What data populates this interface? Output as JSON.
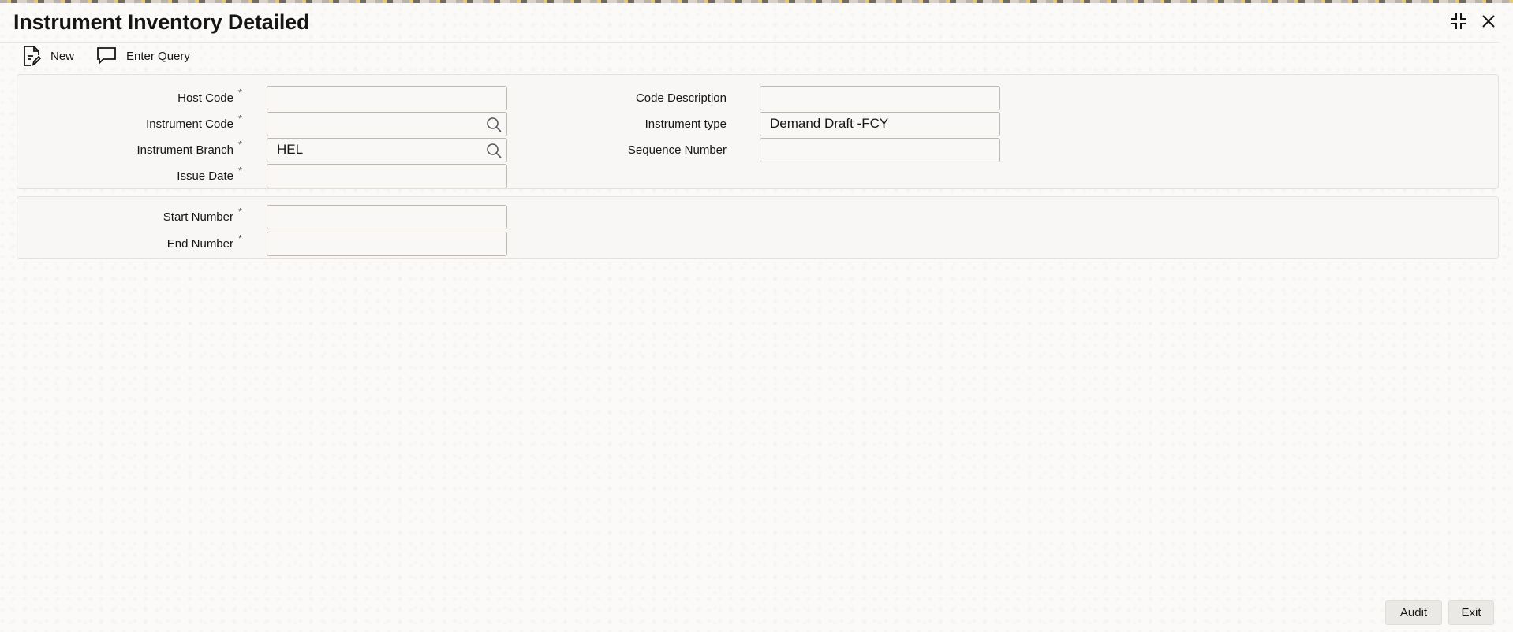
{
  "window": {
    "title": "Instrument Inventory Detailed",
    "controls": [
      "collapse-icon",
      "close-icon"
    ]
  },
  "toolbar": {
    "new_label": "New",
    "enter_query_label": "Enter Query"
  },
  "form": {
    "required_marker": "*",
    "host_code": {
      "label": "Host Code",
      "value": ""
    },
    "instrument_code": {
      "label": "Instrument Code",
      "value": ""
    },
    "instrument_branch": {
      "label": "Instrument Branch",
      "value": "HEL"
    },
    "issue_date": {
      "label": "Issue Date",
      "value": ""
    },
    "code_description": {
      "label": "Code Description",
      "value": ""
    },
    "instrument_type": {
      "label": "Instrument type",
      "value": "Demand Draft -FCY"
    },
    "sequence_number": {
      "label": "Sequence Number",
      "value": ""
    },
    "start_number": {
      "label": "Start Number",
      "value": ""
    },
    "end_number": {
      "label": "End Number",
      "value": ""
    }
  },
  "footer": {
    "audit_label": "Audit",
    "exit_label": "Exit"
  }
}
